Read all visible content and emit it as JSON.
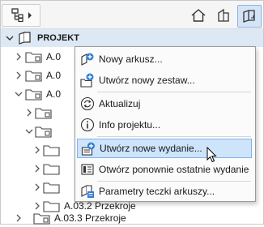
{
  "tree": {
    "root_label": "PROJEKT",
    "rows": [
      {
        "label": "A.0"
      },
      {
        "label": "A.0"
      },
      {
        "label": "A.0"
      },
      {
        "label": ""
      },
      {
        "label": ""
      },
      {
        "label": ""
      },
      {
        "label": ""
      },
      {
        "label": ""
      },
      {
        "label": "A.03.2 Przekroje"
      },
      {
        "label": "A.03.3 Przekroje"
      }
    ]
  },
  "context_menu": {
    "items": [
      {
        "label": "Nowy arkusz...",
        "icon": "new-sheet-icon"
      },
      {
        "label": "Utwórz nowy zestaw...",
        "icon": "new-set-icon"
      },
      {
        "label": "Aktualizuj",
        "icon": "refresh-icon"
      },
      {
        "label": "Info projektu...",
        "icon": "info-icon"
      },
      {
        "label": "Utwórz nowe wydanie...",
        "icon": "new-issue-icon"
      },
      {
        "label": "Otwórz ponownie ostatnie wydanie",
        "icon": "reopen-issue-icon"
      },
      {
        "label": "Parametry teczki arkuszy...",
        "icon": "folder-settings-icon"
      }
    ],
    "highlighted": "Utwórz nowe wydanie..."
  }
}
